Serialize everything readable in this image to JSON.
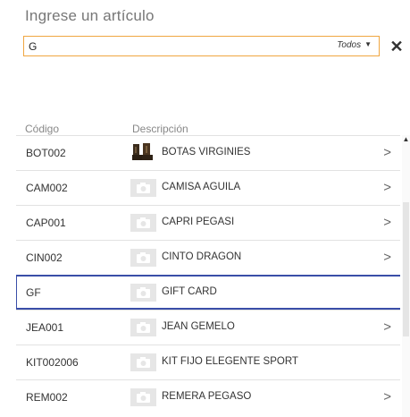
{
  "header": {
    "title": "Ingrese un artículo"
  },
  "search": {
    "value": "G",
    "filter_label": "Todos"
  },
  "clear_label": "✕",
  "columns": {
    "code": "Código",
    "description": "Descripción"
  },
  "rows": [
    {
      "code": "BOT002",
      "description": "BOTAS VIRGINIES",
      "thumb": "boots-photo",
      "chevron": ">"
    },
    {
      "code": "CAM002",
      "description": "CAMISA AGUILA",
      "thumb": "camera-icon",
      "chevron": ">"
    },
    {
      "code": "CAP001",
      "description": "CAPRI PEGASI",
      "thumb": "camera-icon",
      "chevron": ">"
    },
    {
      "code": "CIN002",
      "description": "CINTO DRAGON",
      "thumb": "camera-icon",
      "chevron": ">"
    },
    {
      "code": "GF",
      "description": "GIFT CARD",
      "thumb": "camera-icon",
      "chevron": ""
    },
    {
      "code": "JEA001",
      "description": "JEAN GEMELO",
      "thumb": "camera-icon",
      "chevron": ">"
    },
    {
      "code": "KIT002006",
      "description": "KIT FIJO ELEGENTE SPORT",
      "thumb": "camera-icon",
      "chevron": ""
    },
    {
      "code": "REM002",
      "description": "REMERA PEGASO",
      "thumb": "camera-icon",
      "chevron": ">"
    }
  ],
  "colors": {
    "accent_border": "#f0a641",
    "selection": "#3a4ea8"
  }
}
